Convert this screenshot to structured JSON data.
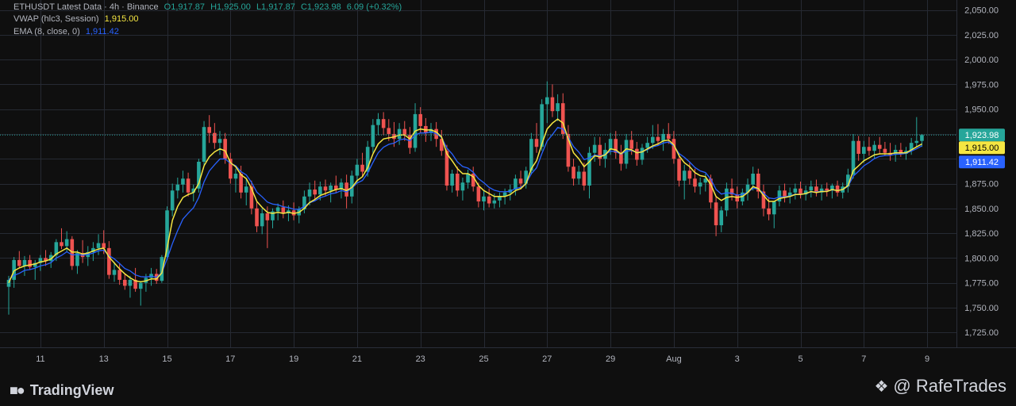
{
  "header": {
    "line1": {
      "symbol": "ETHUSDT Latest Data · 4h · Binance",
      "open": "O1,917.87",
      "high": "H1,925.00",
      "low": "L1,917.87",
      "close": "C1,923.98",
      "change": "6.09 (+0.32%)"
    },
    "line2": {
      "label": "VWAP (hlc3, Session)",
      "value": "1,915.00"
    },
    "line3": {
      "label": "EMA (8, close, 0)",
      "value": "1,911.42"
    }
  },
  "brand": {
    "logo_text": "TradingView",
    "icon": "tradingview-logo-icon"
  },
  "watermark": {
    "text": "@ RafeTrades",
    "icon": "binance-diamond-icon"
  },
  "colors": {
    "background": "#0f0f0f",
    "grid": "#262a33",
    "up": "#26a69a",
    "down": "#ef5350",
    "vwap": "#f5e642",
    "ema": "#2962ff",
    "axis_text": "#b2b5be"
  },
  "chart_data": {
    "type": "candlestick",
    "interval": "4h",
    "ylim": [
      1710,
      2060
    ],
    "y_ticks": [
      "2,050.00",
      "2,025.00",
      "2,000.00",
      "1,975.00",
      "1,950.00",
      "1,925.00",
      "1,900.00",
      "1,875.00",
      "1,850.00",
      "1,825.00",
      "1,800.00",
      "1,775.00",
      "1,750.00",
      "1,725.00"
    ],
    "y_tick_values": [
      2050,
      2025,
      2000,
      1975,
      1950,
      1925,
      1900,
      1875,
      1850,
      1825,
      1800,
      1775,
      1750,
      1725
    ],
    "x_ticks": [
      "11",
      "13",
      "15",
      "17",
      "19",
      "21",
      "23",
      "25",
      "27",
      "29",
      "Aug",
      "3",
      "5",
      "7",
      "9"
    ],
    "x_tick_index": [
      6,
      18,
      30,
      42,
      54,
      66,
      78,
      90,
      102,
      114,
      126,
      138,
      150,
      162,
      174
    ],
    "price_labels": [
      {
        "label": "last",
        "value": 1923.98,
        "text": "1,923.98",
        "color": "#26a69a"
      },
      {
        "label": "vwap",
        "value": 1915.0,
        "text": "1,915.00",
        "color": "#f5e642"
      },
      {
        "label": "ema",
        "value": 1911.42,
        "text": "1,911.42",
        "color": "#2962ff"
      }
    ],
    "candles": [
      [
        1771,
        1782,
        1743,
        1778
      ],
      [
        1778,
        1801,
        1770,
        1798
      ],
      [
        1798,
        1807,
        1790,
        1792
      ],
      [
        1792,
        1802,
        1782,
        1798
      ],
      [
        1798,
        1803,
        1788,
        1791
      ],
      [
        1791,
        1798,
        1778,
        1795
      ],
      [
        1795,
        1803,
        1787,
        1800
      ],
      [
        1800,
        1808,
        1792,
        1797
      ],
      [
        1797,
        1806,
        1790,
        1803
      ],
      [
        1803,
        1819,
        1797,
        1816
      ],
      [
        1816,
        1830,
        1809,
        1812
      ],
      [
        1812,
        1827,
        1806,
        1819
      ],
      [
        1819,
        1822,
        1788,
        1792
      ],
      [
        1792,
        1808,
        1784,
        1805
      ],
      [
        1805,
        1818,
        1795,
        1801
      ],
      [
        1801,
        1812,
        1792,
        1806
      ],
      [
        1806,
        1816,
        1797,
        1810
      ],
      [
        1810,
        1824,
        1803,
        1815
      ],
      [
        1815,
        1828,
        1804,
        1810
      ],
      [
        1810,
        1817,
        1779,
        1783
      ],
      [
        1783,
        1796,
        1776,
        1788
      ],
      [
        1788,
        1794,
        1773,
        1778
      ],
      [
        1778,
        1784,
        1768,
        1772
      ],
      [
        1772,
        1782,
        1760,
        1778
      ],
      [
        1778,
        1790,
        1766,
        1769
      ],
      [
        1769,
        1776,
        1752,
        1775
      ],
      [
        1775,
        1784,
        1766,
        1780
      ],
      [
        1780,
        1790,
        1772,
        1784
      ],
      [
        1784,
        1789,
        1774,
        1777
      ],
      [
        1777,
        1803,
        1775,
        1801
      ],
      [
        1801,
        1852,
        1798,
        1848
      ],
      [
        1848,
        1875,
        1842,
        1868
      ],
      [
        1868,
        1881,
        1860,
        1874
      ],
      [
        1874,
        1888,
        1866,
        1880
      ],
      [
        1880,
        1886,
        1862,
        1866
      ],
      [
        1866,
        1874,
        1857,
        1870
      ],
      [
        1870,
        1900,
        1866,
        1897
      ],
      [
        1897,
        1938,
        1892,
        1932
      ],
      [
        1932,
        1944,
        1916,
        1926
      ],
      [
        1926,
        1936,
        1910,
        1916
      ],
      [
        1916,
        1928,
        1904,
        1920
      ],
      [
        1920,
        1926,
        1895,
        1900
      ],
      [
        1900,
        1906,
        1875,
        1880
      ],
      [
        1880,
        1890,
        1866,
        1885
      ],
      [
        1885,
        1893,
        1860,
        1866
      ],
      [
        1866,
        1880,
        1853,
        1872
      ],
      [
        1872,
        1878,
        1844,
        1850
      ],
      [
        1850,
        1857,
        1826,
        1832
      ],
      [
        1832,
        1850,
        1824,
        1845
      ],
      [
        1845,
        1852,
        1810,
        1838
      ],
      [
        1838,
        1850,
        1830,
        1847
      ],
      [
        1847,
        1855,
        1838,
        1851
      ],
      [
        1851,
        1858,
        1840,
        1845
      ],
      [
        1845,
        1853,
        1837,
        1848
      ],
      [
        1848,
        1856,
        1838,
        1843
      ],
      [
        1843,
        1852,
        1835,
        1849
      ],
      [
        1849,
        1868,
        1845,
        1862
      ],
      [
        1862,
        1876,
        1853,
        1869
      ],
      [
        1869,
        1878,
        1858,
        1864
      ],
      [
        1864,
        1877,
        1858,
        1872
      ],
      [
        1872,
        1879,
        1862,
        1868
      ],
      [
        1868,
        1876,
        1856,
        1873
      ],
      [
        1873,
        1883,
        1866,
        1869
      ],
      [
        1869,
        1880,
        1860,
        1876
      ],
      [
        1876,
        1884,
        1850,
        1862
      ],
      [
        1862,
        1888,
        1855,
        1883
      ],
      [
        1883,
        1900,
        1876,
        1894
      ],
      [
        1894,
        1906,
        1882,
        1887
      ],
      [
        1887,
        1918,
        1882,
        1912
      ],
      [
        1912,
        1940,
        1906,
        1934
      ],
      [
        1934,
        1946,
        1924,
        1940
      ],
      [
        1940,
        1947,
        1924,
        1931
      ],
      [
        1931,
        1940,
        1918,
        1925
      ],
      [
        1925,
        1937,
        1912,
        1920
      ],
      [
        1920,
        1936,
        1914,
        1930
      ],
      [
        1930,
        1938,
        1918,
        1924
      ],
      [
        1924,
        1932,
        1905,
        1911
      ],
      [
        1911,
        1956,
        1907,
        1945
      ],
      [
        1945,
        1952,
        1926,
        1933
      ],
      [
        1933,
        1941,
        1917,
        1926
      ],
      [
        1926,
        1936,
        1918,
        1930
      ],
      [
        1930,
        1937,
        1912,
        1920
      ],
      [
        1920,
        1929,
        1903,
        1908
      ],
      [
        1908,
        1914,
        1868,
        1873
      ],
      [
        1873,
        1889,
        1866,
        1885
      ],
      [
        1885,
        1892,
        1862,
        1868
      ],
      [
        1868,
        1881,
        1858,
        1876
      ],
      [
        1876,
        1889,
        1870,
        1885
      ],
      [
        1885,
        1892,
        1867,
        1872
      ],
      [
        1872,
        1876,
        1851,
        1857
      ],
      [
        1857,
        1868,
        1848,
        1862
      ],
      [
        1862,
        1870,
        1851,
        1855
      ],
      [
        1855,
        1865,
        1850,
        1858
      ],
      [
        1858,
        1866,
        1851,
        1862
      ],
      [
        1862,
        1870,
        1854,
        1866
      ],
      [
        1866,
        1874,
        1858,
        1869
      ],
      [
        1869,
        1884,
        1863,
        1880
      ],
      [
        1880,
        1888,
        1869,
        1875
      ],
      [
        1875,
        1892,
        1870,
        1888
      ],
      [
        1888,
        1926,
        1884,
        1920
      ],
      [
        1920,
        1936,
        1906,
        1912
      ],
      [
        1912,
        1960,
        1908,
        1955
      ],
      [
        1955,
        1978,
        1936,
        1962
      ],
      [
        1962,
        1975,
        1942,
        1948
      ],
      [
        1948,
        1965,
        1938,
        1956
      ],
      [
        1956,
        1966,
        1920,
        1925
      ],
      [
        1925,
        1934,
        1887,
        1892
      ],
      [
        1892,
        1900,
        1873,
        1880
      ],
      [
        1880,
        1893,
        1874,
        1887
      ],
      [
        1887,
        1896,
        1868,
        1873
      ],
      [
        1873,
        1912,
        1860,
        1906
      ],
      [
        1906,
        1922,
        1897,
        1914
      ],
      [
        1914,
        1922,
        1893,
        1900
      ],
      [
        1900,
        1916,
        1891,
        1909
      ],
      [
        1909,
        1926,
        1904,
        1920
      ],
      [
        1920,
        1928,
        1900,
        1906
      ],
      [
        1906,
        1914,
        1888,
        1895
      ],
      [
        1895,
        1925,
        1890,
        1919
      ],
      [
        1919,
        1928,
        1904,
        1910
      ],
      [
        1910,
        1917,
        1893,
        1899
      ],
      [
        1899,
        1915,
        1894,
        1911
      ],
      [
        1911,
        1922,
        1906,
        1916
      ],
      [
        1916,
        1934,
        1910,
        1922
      ],
      [
        1922,
        1935,
        1913,
        1918
      ],
      [
        1918,
        1930,
        1908,
        1925
      ],
      [
        1925,
        1936,
        1915,
        1920
      ],
      [
        1920,
        1928,
        1895,
        1900
      ],
      [
        1900,
        1905,
        1872,
        1878
      ],
      [
        1878,
        1894,
        1859,
        1888
      ],
      [
        1888,
        1896,
        1874,
        1880
      ],
      [
        1880,
        1890,
        1866,
        1872
      ],
      [
        1872,
        1881,
        1864,
        1876
      ],
      [
        1876,
        1885,
        1867,
        1880
      ],
      [
        1880,
        1884,
        1850,
        1856
      ],
      [
        1856,
        1862,
        1822,
        1833
      ],
      [
        1833,
        1852,
        1826,
        1848
      ],
      [
        1848,
        1876,
        1842,
        1870
      ],
      [
        1870,
        1880,
        1858,
        1864
      ],
      [
        1864,
        1872,
        1850,
        1857
      ],
      [
        1857,
        1870,
        1853,
        1866
      ],
      [
        1866,
        1880,
        1858,
        1874
      ],
      [
        1874,
        1892,
        1868,
        1885
      ],
      [
        1885,
        1890,
        1860,
        1867
      ],
      [
        1867,
        1874,
        1842,
        1850
      ],
      [
        1850,
        1861,
        1838,
        1844
      ],
      [
        1844,
        1852,
        1830,
        1857
      ],
      [
        1857,
        1873,
        1852,
        1868
      ],
      [
        1868,
        1875,
        1856,
        1862
      ],
      [
        1862,
        1871,
        1855,
        1866
      ],
      [
        1866,
        1875,
        1859,
        1870
      ],
      [
        1870,
        1877,
        1860,
        1864
      ],
      [
        1864,
        1873,
        1858,
        1868
      ],
      [
        1868,
        1878,
        1861,
        1872
      ],
      [
        1872,
        1879,
        1862,
        1866
      ],
      [
        1866,
        1874,
        1858,
        1870
      ],
      [
        1870,
        1876,
        1862,
        1868
      ],
      [
        1868,
        1875,
        1860,
        1873
      ],
      [
        1873,
        1878,
        1862,
        1866
      ],
      [
        1866,
        1876,
        1860,
        1872
      ],
      [
        1872,
        1890,
        1866,
        1884
      ],
      [
        1884,
        1925,
        1880,
        1918
      ],
      [
        1918,
        1923,
        1898,
        1905
      ],
      [
        1905,
        1918,
        1896,
        1912
      ],
      [
        1912,
        1922,
        1903,
        1908
      ],
      [
        1908,
        1918,
        1900,
        1914
      ],
      [
        1914,
        1922,
        1905,
        1910
      ],
      [
        1910,
        1917,
        1903,
        1906
      ],
      [
        1906,
        1916,
        1898,
        1904
      ],
      [
        1904,
        1914,
        1897,
        1909
      ],
      [
        1909,
        1916,
        1902,
        1905
      ],
      [
        1905,
        1912,
        1899,
        1908
      ],
      [
        1908,
        1921,
        1904,
        1916
      ],
      [
        1916,
        1942,
        1912,
        1918
      ],
      [
        1918,
        1925,
        1912,
        1923.98
      ]
    ],
    "vwap": [
      1775,
      1787,
      1790,
      1792,
      1793,
      1794,
      1796,
      1797,
      1799,
      1804,
      1807,
      1810,
      1806,
      1806,
      1804,
      1805,
      1807,
      1809,
      1810,
      1801,
      1795,
      1789,
      1784,
      1780,
      1777,
      1776,
      1777,
      1779,
      1779,
      1785,
      1810,
      1838,
      1852,
      1861,
      1864,
      1866,
      1875,
      1893,
      1902,
      1907,
      1910,
      1908,
      1896,
      1892,
      1884,
      1880,
      1870,
      1857,
      1851,
      1846,
      1845,
      1846,
      1845,
      1846,
      1845,
      1846,
      1850,
      1856,
      1859,
      1863,
      1865,
      1867,
      1869,
      1870,
      1868,
      1871,
      1878,
      1882,
      1891,
      1905,
      1915,
      1920,
      1921,
      1922,
      1924,
      1924,
      1920,
      1928,
      1930,
      1929,
      1929,
      1927,
      1922,
      1905,
      1898,
      1890,
      1885,
      1885,
      1882,
      1873,
      1868,
      1865,
      1862,
      1862,
      1862,
      1864,
      1868,
      1870,
      1875,
      1890,
      1898,
      1915,
      1930,
      1936,
      1940,
      1936,
      1920,
      1906,
      1900,
      1892,
      1897,
      1903,
      1902,
      1904,
      1910,
      1909,
      1905,
      1910,
      1909,
      1906,
      1907,
      1910,
      1913,
      1915,
      1918,
      1919,
      1914,
      1903,
      1896,
      1892,
      1886,
      1883,
      1882,
      1874,
      1862,
      1858,
      1861,
      1862,
      1861,
      1862,
      1866,
      1872,
      1870,
      1863,
      1857,
      1857,
      1860,
      1861,
      1862,
      1864,
      1864,
      1865,
      1867,
      1866,
      1867,
      1867,
      1869,
      1868,
      1869,
      1873,
      1888,
      1893,
      1898,
      1901,
      1904,
      1905,
      1905,
      1905,
      1906,
      1906,
      1906,
      1909,
      1912,
      1915
    ]
  }
}
